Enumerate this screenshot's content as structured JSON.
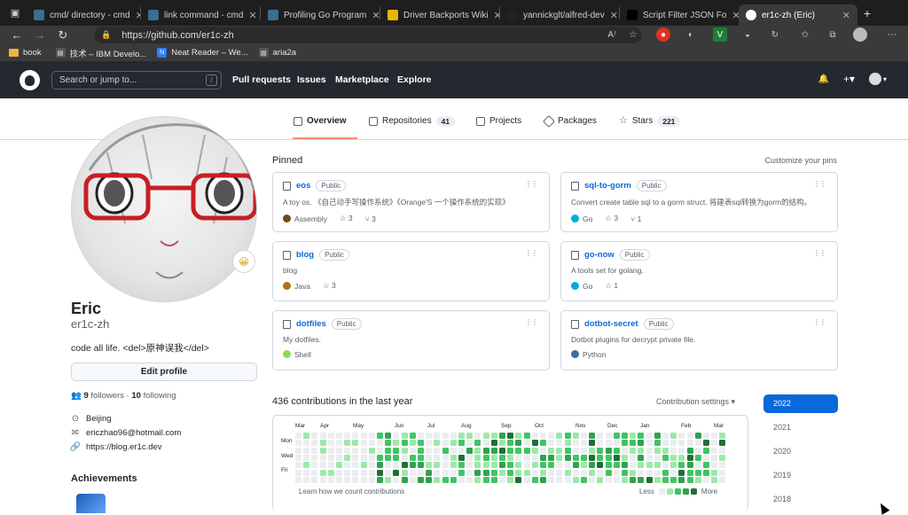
{
  "browser": {
    "tabs": [
      {
        "title": "cmd/ directory - cmd"
      },
      {
        "title": "link command - cmd"
      },
      {
        "title": "Profiling Go Program"
      },
      {
        "title": "Driver Backports Wiki"
      },
      {
        "title": "yannickglt/alfred-dev"
      },
      {
        "title": "Script Filter JSON Fo"
      },
      {
        "title": "er1c-zh (Eric)",
        "active": true
      }
    ],
    "new_tab": "+",
    "url": "https://github.com/er1c-zh",
    "bookmarks": [
      "book",
      "技术 – IBM Develo...",
      "Neat Reader – We...",
      "aria2a"
    ]
  },
  "github": {
    "search_placeholder": "Search or jump to...",
    "slash": "/",
    "nav": [
      "Pull requests",
      "Issues",
      "Marketplace",
      "Explore"
    ],
    "right": {
      "bell": "🔔",
      "plus": "+▾",
      "avatar": "▾"
    }
  },
  "profile_tabs": [
    {
      "label": "Overview",
      "selected": true
    },
    {
      "label": "Repositories",
      "count": "41"
    },
    {
      "label": "Projects"
    },
    {
      "label": "Packages"
    },
    {
      "label": "Stars",
      "count": "221"
    }
  ],
  "profile": {
    "name": "Eric",
    "username": "er1c-zh",
    "bio": "code all life. <del>原神误我</del>",
    "edit_label": "Edit profile",
    "followers": "9",
    "followers_label": "followers",
    "following": "10",
    "following_label": "following",
    "location": "Beijing",
    "email": "ericzhao96@hotmail.com",
    "website": "https://blog.er1c.dev",
    "achievements_title": "Achievements",
    "status_emoji": "😀"
  },
  "pinned": {
    "title": "Pinned",
    "customize": "Customize your pins",
    "public_label": "Public",
    "repos": [
      {
        "name": "eos",
        "desc": "A toy os. 《自己动手写操作系统》《Orange'S 一个操作系统的实现》",
        "lang": "Assembly",
        "lang_color": "#6E4C13",
        "stars": "3",
        "forks": "3"
      },
      {
        "name": "sql-to-gorm",
        "desc": "Convert create table sql to a gorm struct. 将建表sql转换为gorm的结构。",
        "lang": "Go",
        "lang_color": "#00ADD8",
        "stars": "3",
        "forks": "1"
      },
      {
        "name": "blog",
        "desc": "blog",
        "lang": "Java",
        "lang_color": "#b07219",
        "stars": "3"
      },
      {
        "name": "go-now",
        "desc": "A tools set for golang.",
        "lang": "Go",
        "lang_color": "#00ADD8",
        "stars": "1"
      },
      {
        "name": "dotfiles",
        "desc": "My dotfiles.",
        "lang": "Shell",
        "lang_color": "#89e051"
      },
      {
        "name": "dotbot-secret",
        "desc": "Dotbot plugins for decrypt private file.",
        "lang": "Python",
        "lang_color": "#3572A5"
      }
    ]
  },
  "contributions": {
    "title": "436 contributions in the last year",
    "settings": "Contribution settings ▾",
    "months": [
      "Mar",
      "Apr",
      "May",
      "Jun",
      "Jul",
      "Aug",
      "Sep",
      "Oct",
      "Nov",
      "Dec",
      "Jan",
      "Feb",
      "Mar"
    ],
    "days": [
      "Mon",
      "Wed",
      "Fri"
    ],
    "learn": "Learn how we count contributions",
    "less": "Less",
    "more": "More",
    "levels": [
      "#ebedf0",
      "#9be9a8",
      "#40c463",
      "#30a14e",
      "#216e39"
    ],
    "years": [
      "2022",
      "2021",
      "2020",
      "2019",
      "2018"
    ]
  }
}
